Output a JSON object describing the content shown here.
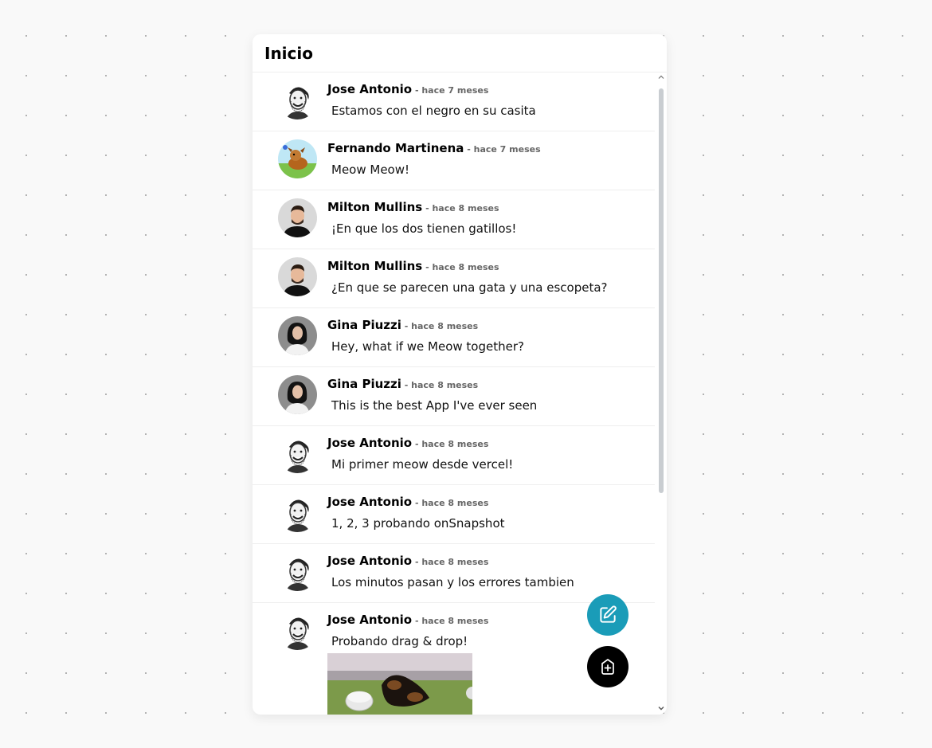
{
  "header": {
    "title": "Inicio"
  },
  "posts": [
    {
      "name": "Jose Antonio",
      "sep": " - ",
      "time": "hace 7 meses",
      "text": "Estamos con el negro en su casita",
      "avatar": "sketch-avatar"
    },
    {
      "name": "Fernando Martinena",
      "sep": " - ",
      "time": "hace 7 meses",
      "text": "Meow Meow!",
      "avatar": "cartoon-dog-avatar"
    },
    {
      "name": "Milton Mullins",
      "sep": " - ",
      "time": "hace 8 meses",
      "text": "¡En que los dos tienen gatillos!",
      "avatar": "man-photo-avatar"
    },
    {
      "name": "Milton Mullins",
      "sep": " - ",
      "time": "hace 8 meses",
      "text": "¿En que se parecen una gata y una escopeta?",
      "avatar": "man-photo-avatar"
    },
    {
      "name": "Gina Piuzzi",
      "sep": " - ",
      "time": "hace 8 meses",
      "text": "Hey, what if we Meow together?",
      "avatar": "woman-photo-avatar"
    },
    {
      "name": "Gina Piuzzi",
      "sep": " - ",
      "time": "hace 8 meses",
      "text": "This is the best App I've ever seen",
      "avatar": "woman-photo-avatar"
    },
    {
      "name": "Jose Antonio",
      "sep": " - ",
      "time": "hace 8 meses",
      "text": "Mi primer meow desde vercel!",
      "avatar": "sketch-avatar"
    },
    {
      "name": "Jose Antonio",
      "sep": " - ",
      "time": "hace 8 meses",
      "text": "1, 2, 3 probando onSnapshot",
      "avatar": "sketch-avatar"
    },
    {
      "name": "Jose Antonio",
      "sep": " - ",
      "time": "hace 8 meses",
      "text": "Los minutos pasan y los errores tambien",
      "avatar": "sketch-avatar"
    },
    {
      "name": "Jose Antonio",
      "sep": " - ",
      "time": "hace 8 meses",
      "text": "Probando drag & drop!",
      "avatar": "sketch-avatar",
      "image": "dog-on-grass-photo"
    }
  ],
  "fabs": {
    "edit_icon": "edit-icon",
    "add_icon": "add-square-icon"
  },
  "colors": {
    "edit_fab": "#1a9cb8",
    "add_fab": "#000000",
    "scroll_thumb": "#c9cdd1"
  }
}
